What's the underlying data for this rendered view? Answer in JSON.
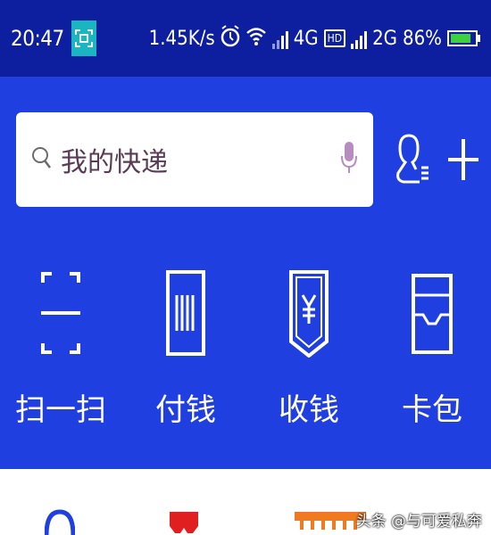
{
  "status_bar": {
    "time": "20:47",
    "net_speed": "1.45K/s",
    "network_4g": "4G",
    "hd_label": "HD",
    "network_2g": "2G",
    "battery_percent": "86%",
    "battery_level": 0.86,
    "icons": [
      "screenshot-icon",
      "alarm-icon",
      "wifi-icon",
      "signal-icon",
      "battery-icon"
    ]
  },
  "search": {
    "placeholder": "我的快递",
    "icons": [
      "search-icon",
      "microphone-icon"
    ]
  },
  "header_actions": {
    "icons": [
      "contacts-icon",
      "plus-icon"
    ]
  },
  "quick_actions": [
    {
      "label": "扫一扫",
      "icon": "scan-icon"
    },
    {
      "label": "付钱",
      "icon": "pay-code-icon"
    },
    {
      "label": "收钱",
      "icon": "receive-money-icon"
    },
    {
      "label": "卡包",
      "icon": "card-wallet-icon"
    }
  ],
  "watermark": "头条 @与可爱私奔",
  "colors": {
    "status_bar": "#0d1f9e",
    "main_background": "#1f3fe0",
    "accent_battery": "#3ed13e",
    "screenshot_badge": "#19b5c0",
    "tab_blue": "#1f3fe0",
    "tab_red": "#e02020",
    "tab_orange": "#f07a20"
  }
}
